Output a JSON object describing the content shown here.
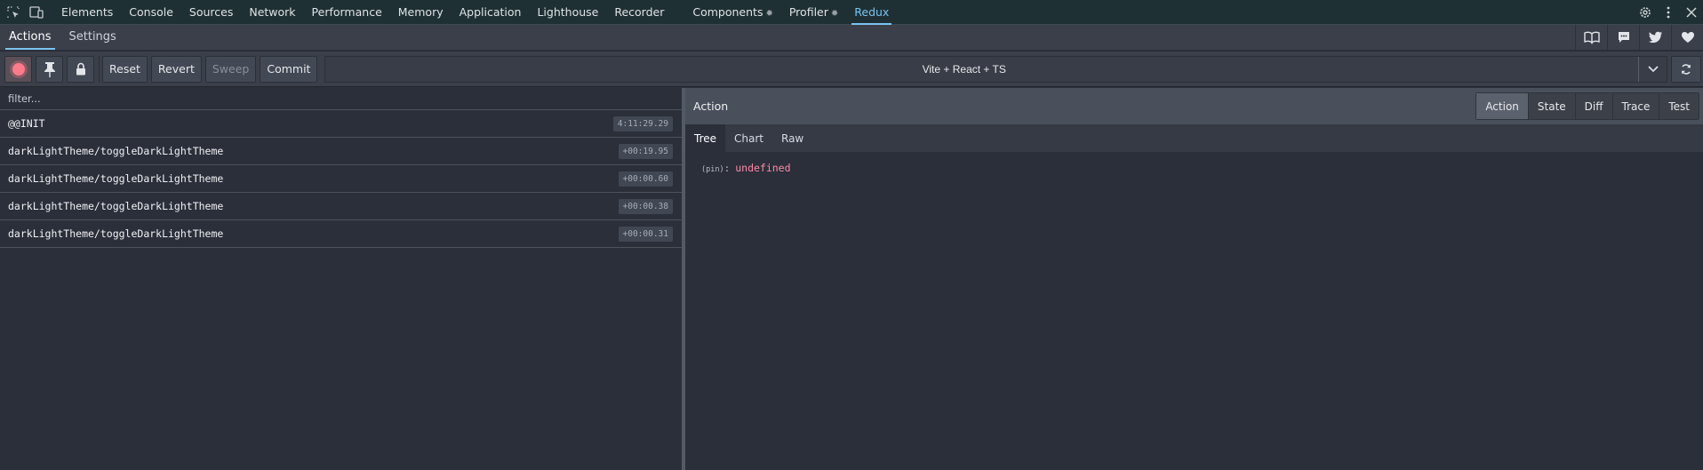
{
  "devtools": {
    "tabs": [
      {
        "label": "Elements"
      },
      {
        "label": "Console"
      },
      {
        "label": "Sources"
      },
      {
        "label": "Network"
      },
      {
        "label": "Performance"
      },
      {
        "label": "Memory"
      },
      {
        "label": "Application"
      },
      {
        "label": "Lighthouse"
      },
      {
        "label": "Recorder"
      },
      {
        "label": "Components",
        "has_gear": true
      },
      {
        "label": "Profiler",
        "has_gear": true
      },
      {
        "label": "Redux",
        "active": true
      }
    ],
    "left_icons": [
      "inspect-element-icon",
      "device-toolbar-icon"
    ],
    "right_icons": [
      "settings-gear-icon",
      "more-options-icon",
      "close-icon"
    ],
    "active_color": "#7cc4f0"
  },
  "redux": {
    "tabs": {
      "actions": "Actions",
      "settings": "Settings"
    },
    "header_icons": [
      "book-icon",
      "chat-icon",
      "twitter-icon",
      "heart-icon"
    ],
    "toolbar": {
      "record_icon": "record-icon",
      "pin_icon": "pin-icon",
      "lock_icon": "lock-icon",
      "reset": "Reset",
      "revert": "Revert",
      "sweep": "Sweep",
      "commit": "Commit",
      "instance": "Vite + React + TS",
      "sync_icon": "sync-icon"
    },
    "filter_placeholder": "filter...",
    "actions": [
      {
        "name": "@@INIT",
        "time": "4:11:29.29"
      },
      {
        "name": "darkLightTheme/toggleDarkLightTheme",
        "time": "+00:19.95"
      },
      {
        "name": "darkLightTheme/toggleDarkLightTheme",
        "time": "+00:00.60"
      },
      {
        "name": "darkLightTheme/toggleDarkLightTheme",
        "time": "+00:00.38"
      },
      {
        "name": "darkLightTheme/toggleDarkLightTheme",
        "time": "+00:00.31"
      }
    ],
    "inspector": {
      "title": "Action",
      "modes": [
        "Action",
        "State",
        "Diff",
        "Trace",
        "Test"
      ],
      "active_mode": "Action",
      "subtabs": [
        "Tree",
        "Chart",
        "Raw"
      ],
      "active_subtab": "Tree",
      "tree": {
        "key": "(pin)",
        "colon": ":",
        "value": "undefined"
      }
    }
  }
}
